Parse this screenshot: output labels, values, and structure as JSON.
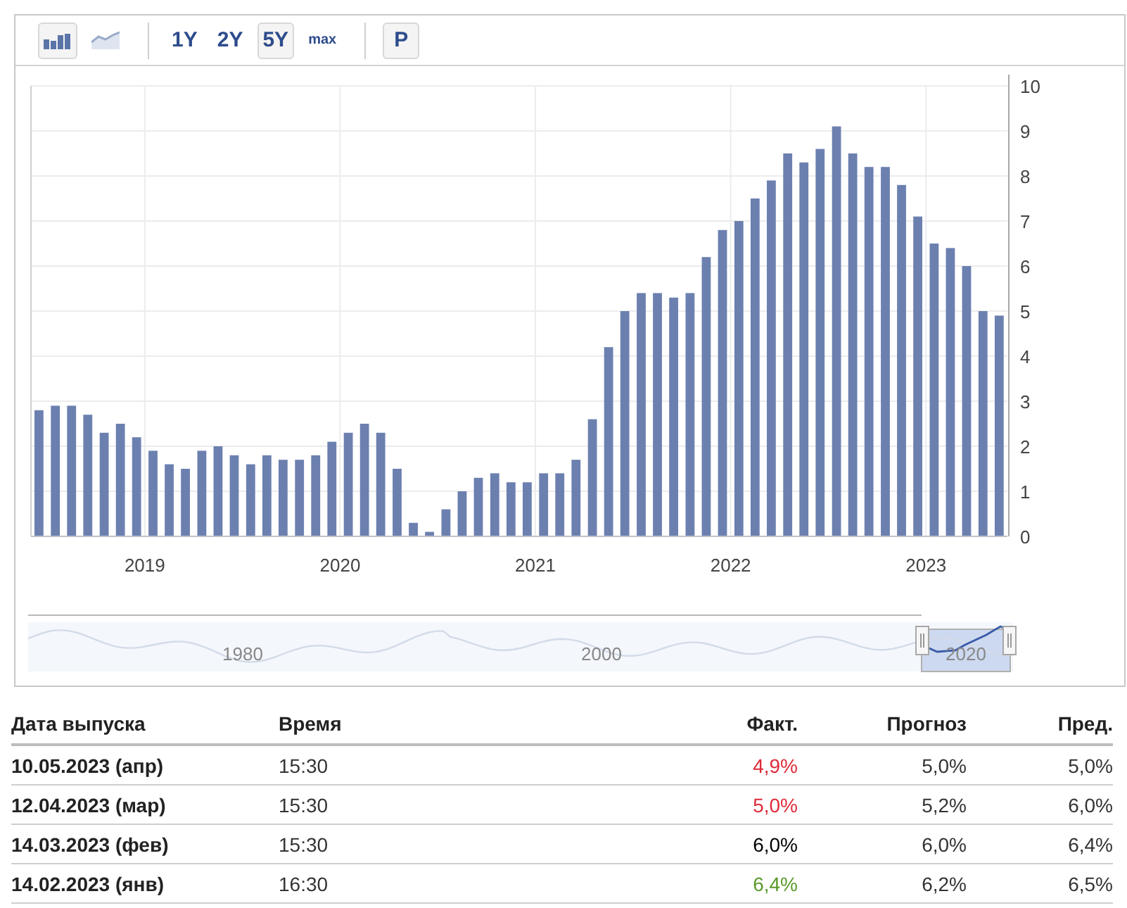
{
  "toolbar": {
    "chart_types": [
      {
        "kind": "bar",
        "selected": true
      },
      {
        "kind": "line",
        "selected": false
      }
    ],
    "ranges": [
      {
        "label": "1Y",
        "selected": false
      },
      {
        "label": "2Y",
        "selected": false
      },
      {
        "label": "5Y",
        "selected": true
      },
      {
        "label": "max",
        "selected": false
      }
    ],
    "p_button": {
      "label": "P"
    }
  },
  "chart": {
    "chart_data": {
      "type": "bar",
      "grid": true,
      "ylim": [
        0,
        10
      ],
      "xlim": [
        2018.417,
        2023.417
      ],
      "x": [
        2018.458,
        2018.542,
        2018.625,
        2018.708,
        2018.792,
        2018.875,
        2018.958,
        2019.042,
        2019.125,
        2019.208,
        2019.292,
        2019.375,
        2019.458,
        2019.542,
        2019.625,
        2019.708,
        2019.792,
        2019.875,
        2019.958,
        2020.042,
        2020.125,
        2020.208,
        2020.292,
        2020.375,
        2020.458,
        2020.542,
        2020.625,
        2020.708,
        2020.792,
        2020.875,
        2020.958,
        2021.042,
        2021.125,
        2021.208,
        2021.292,
        2021.375,
        2021.458,
        2021.542,
        2021.625,
        2021.708,
        2021.792,
        2021.875,
        2021.958,
        2022.042,
        2022.125,
        2022.208,
        2022.292,
        2022.375,
        2022.458,
        2022.542,
        2022.625,
        2022.708,
        2022.792,
        2022.875,
        2022.958,
        2023.042,
        2023.125,
        2023.208,
        2023.292,
        2023.375
      ],
      "yticks": [
        0,
        1,
        2,
        3,
        4,
        5,
        6,
        7,
        8,
        9,
        10
      ],
      "xticks": [
        2019,
        2020,
        2021,
        2022,
        2023
      ],
      "values": [
        2.8,
        2.9,
        2.9,
        2.7,
        2.3,
        2.5,
        2.2,
        1.9,
        1.6,
        1.5,
        1.9,
        2.0,
        1.8,
        1.6,
        1.8,
        1.7,
        1.7,
        1.8,
        2.1,
        2.3,
        2.5,
        2.3,
        1.5,
        0.3,
        0.1,
        0.6,
        1.0,
        1.3,
        1.4,
        1.2,
        1.2,
        1.4,
        1.4,
        1.7,
        2.6,
        4.2,
        5.0,
        5.4,
        5.4,
        5.3,
        5.4,
        6.2,
        6.8,
        7.0,
        7.5,
        7.9,
        8.5,
        8.3,
        8.6,
        9.1,
        8.5,
        8.2,
        8.2,
        7.8,
        7.1,
        6.5,
        6.4,
        6.0,
        5.0,
        4.9
      ]
    },
    "navigator": {
      "labels": [
        "1980",
        "2000",
        "2020"
      ]
    }
  },
  "table": {
    "columns": [
      "Дата выпуска",
      "Время",
      "Факт.",
      "Прогноз",
      "Пред."
    ],
    "rows": [
      {
        "date": "10.05.2023 (апр)",
        "time": "15:30",
        "fact": {
          "text": "4,9%",
          "color": "#dd2a38"
        },
        "forecast": "5,0%",
        "previous": "5,0%"
      },
      {
        "date": "12.04.2023 (мар)",
        "time": "15:30",
        "fact": {
          "text": "5,0%",
          "color": "#dd2a38"
        },
        "forecast": "5,2%",
        "previous": "6,0%"
      },
      {
        "date": "14.03.2023 (фев)",
        "time": "15:30",
        "fact": {
          "text": "6,0%",
          "color": "#000000"
        },
        "forecast": "6,0%",
        "previous": "6,4%"
      },
      {
        "date": "14.02.2023 (янв)",
        "time": "16:30",
        "fact": {
          "text": "6,4%",
          "color": "#5a9a2a"
        },
        "forecast": "6,2%",
        "previous": "6,5%"
      }
    ]
  }
}
